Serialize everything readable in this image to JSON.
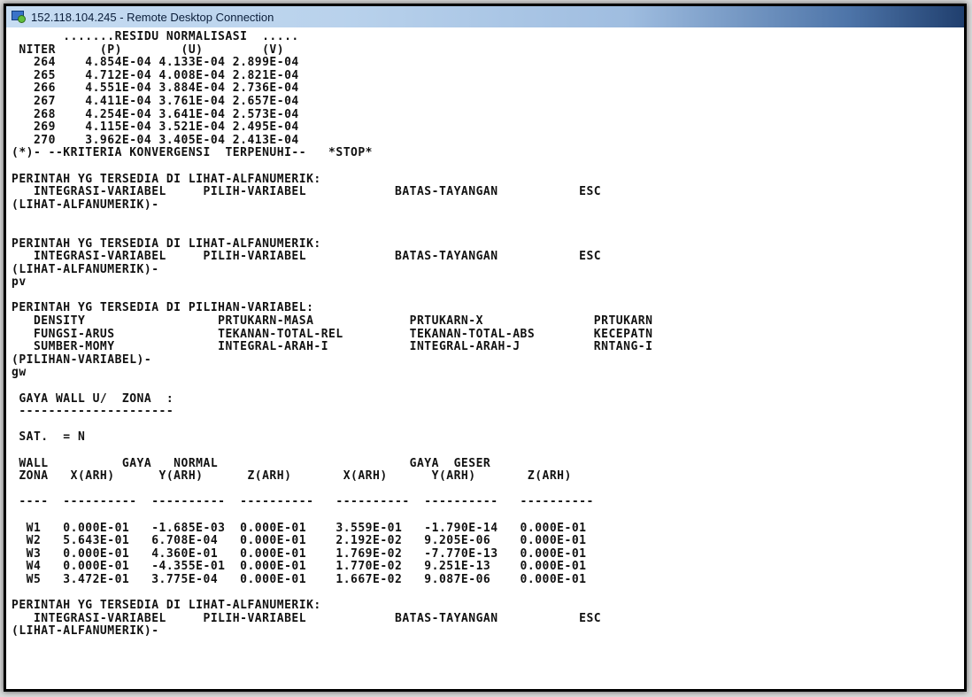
{
  "window": {
    "title": "152.118.104.245 - Remote Desktop Connection",
    "icon": "remote-desktop-icon"
  },
  "console": {
    "lines": [
      "       .......RESIDU NORMALISASI  .....",
      " NITER      (P)        (U)        (V)",
      "   264    4.854E-04 4.133E-04 2.899E-04",
      "   265    4.712E-04 4.008E-04 2.821E-04",
      "   266    4.551E-04 3.884E-04 2.736E-04",
      "   267    4.411E-04 3.761E-04 2.657E-04",
      "   268    4.254E-04 3.641E-04 2.573E-04",
      "   269    4.115E-04 3.521E-04 2.495E-04",
      "   270    3.962E-04 3.405E-04 2.413E-04",
      "(*)- --KRITERIA KONVERGENSI  TERPENUHI--   *STOP*",
      "",
      "PERINTAH YG TERSEDIA DI LIHAT-ALFANUMERIK:",
      "   INTEGRASI-VARIABEL     PILIH-VARIABEL            BATAS-TAYANGAN           ESC",
      "(LIHAT-ALFANUMERIK)-",
      "",
      "",
      "PERINTAH YG TERSEDIA DI LIHAT-ALFANUMERIK:",
      "   INTEGRASI-VARIABEL     PILIH-VARIABEL            BATAS-TAYANGAN           ESC",
      "(LIHAT-ALFANUMERIK)-",
      "pv",
      "",
      "PERINTAH YG TERSEDIA DI PILIHAN-VARIABEL:",
      "   DENSITY                  PRTUKARN-MASA             PRTUKARN-X               PRTUKARN",
      "   FUNGSI-ARUS              TEKANAN-TOTAL-REL         TEKANAN-TOTAL-ABS        KECEPATN",
      "   SUMBER-MOMY              INTEGRAL-ARAH-I           INTEGRAL-ARAH-J          RNTANG-I",
      "(PILIHAN-VARIABEL)-",
      "gw",
      "",
      " GAYA WALL U/  ZONA  :",
      " ---------------------",
      "",
      " SAT.  = N",
      "",
      " WALL          GAYA   NORMAL                          GAYA  GESER",
      " ZONA   X(ARH)      Y(ARH)      Z(ARH)       X(ARH)      Y(ARH)       Z(ARH)",
      "",
      " ----  ----------  ----------  ----------   ----------  ----------   ----------",
      "",
      "  W1   0.000E-01   -1.685E-03  0.000E-01    3.559E-01   -1.790E-14   0.000E-01",
      "  W2   5.643E-01   6.708E-04   0.000E-01    2.192E-02   9.205E-06    0.000E-01",
      "  W3   0.000E-01   4.360E-01   0.000E-01    1.769E-02   -7.770E-13   0.000E-01",
      "  W4   0.000E-01   -4.355E-01  0.000E-01    1.770E-02   9.251E-13    0.000E-01",
      "  W5   3.472E-01   3.775E-04   0.000E-01    1.667E-02   9.087E-06    0.000E-01",
      "",
      "PERINTAH YG TERSEDIA DI LIHAT-ALFANUMERIK:",
      "   INTEGRASI-VARIABEL     PILIH-VARIABEL            BATAS-TAYANGAN           ESC",
      "(LIHAT-ALFANUMERIK)-"
    ]
  }
}
